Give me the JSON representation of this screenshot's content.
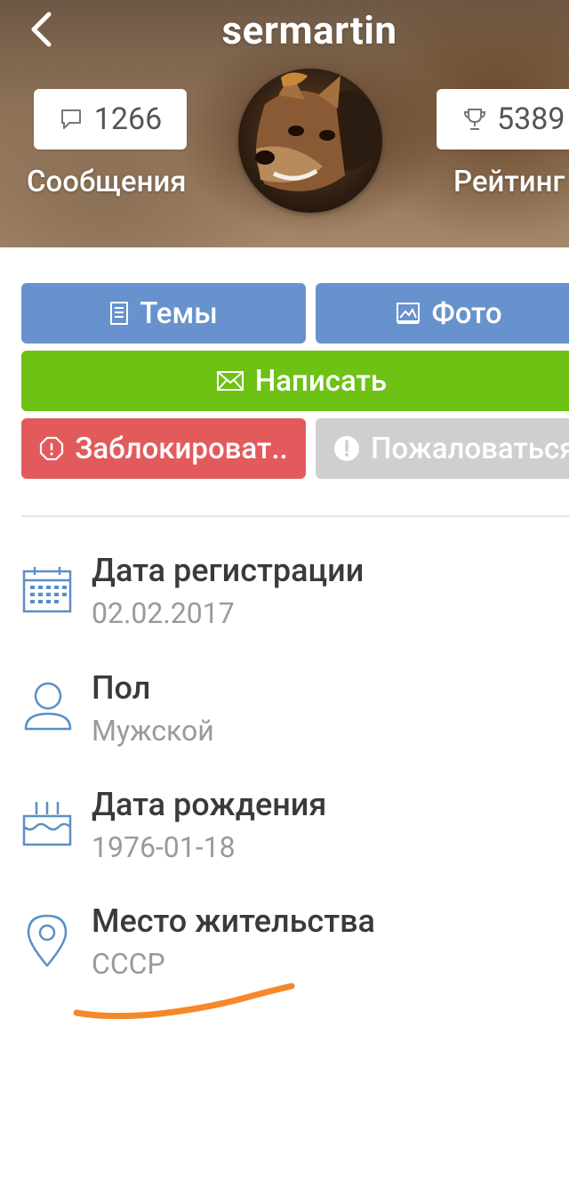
{
  "header": {
    "title": "sermartin",
    "messages_count": "1266",
    "messages_label": "Сообщения",
    "rating_value": "5389",
    "rating_label": "Рейтинг"
  },
  "actions": {
    "topics": "Темы",
    "photo": "Фото",
    "write": "Написать",
    "block": "Заблокироват..",
    "report": "Пожаловаться"
  },
  "info": [
    {
      "label": "Дата регистрации",
      "value": "02.02.2017",
      "icon": "calendar-icon"
    },
    {
      "label": "Пол",
      "value": "Мужской",
      "icon": "person-icon"
    },
    {
      "label": "Дата рождения",
      "value": "1976-01-18",
      "icon": "birthday-cake-icon"
    },
    {
      "label": "Место жительства",
      "value": "СССР",
      "icon": "location-pin-icon"
    }
  ],
  "colors": {
    "primary_blue": "#6892cd",
    "green": "#6dc214",
    "red": "#e35a5d",
    "grey": "#cfcfcf",
    "icon_blue": "#5b8fc7",
    "annotation_orange": "#f5882a"
  }
}
